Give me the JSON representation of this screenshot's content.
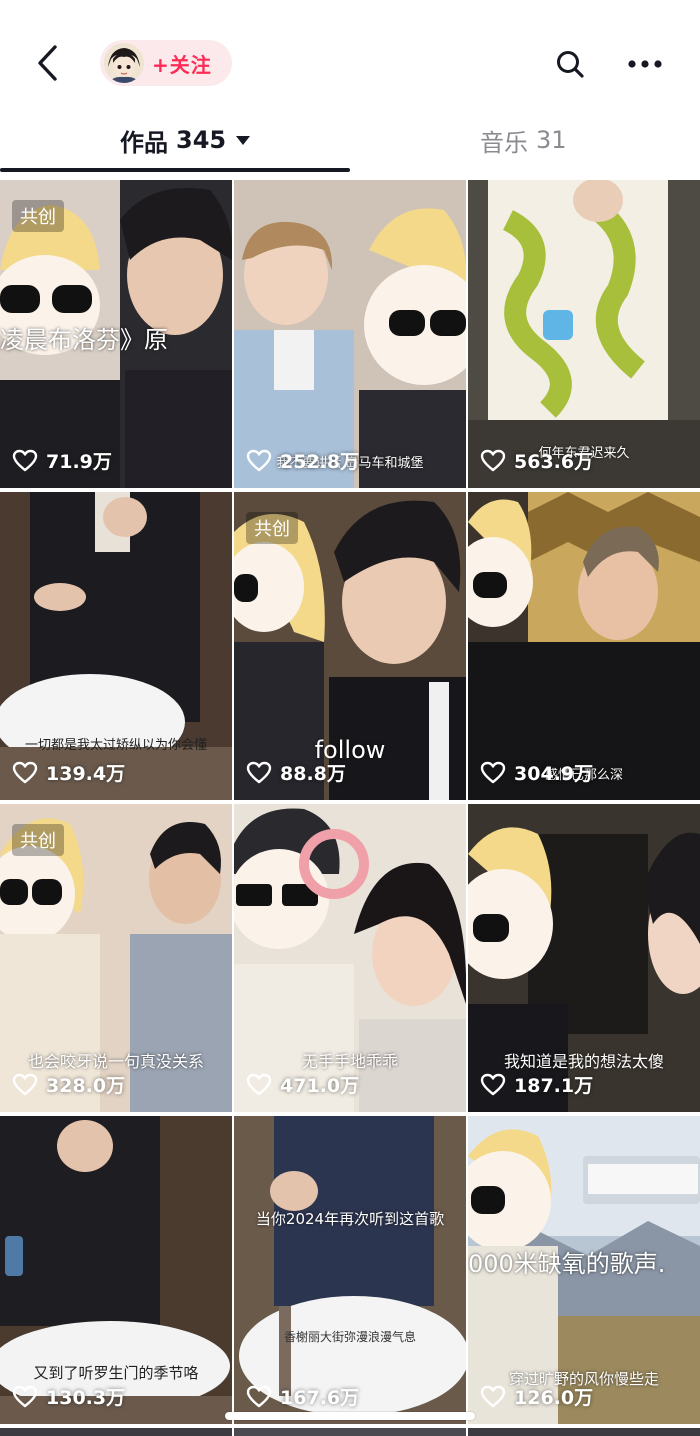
{
  "header": {
    "follow_label": "+关注"
  },
  "tabs": {
    "works_label": "作品",
    "works_count": "345",
    "music_label": "音乐",
    "music_count": "31"
  },
  "videos": [
    {
      "likes": "71.9万",
      "badge": "共创",
      "caption": "凌晨布洛芬》原"
    },
    {
      "likes": "252.8万",
      "badge": "",
      "caption": "我不要讲话  岛马车和城堡"
    },
    {
      "likes": "563.6万",
      "badge": "",
      "caption": "何年东君迟来久"
    },
    {
      "likes": "139.4万",
      "badge": "",
      "caption": "一切都是我太过矫纵以为你会懂"
    },
    {
      "likes": "88.8万",
      "badge": "共创",
      "caption": "follow"
    },
    {
      "likes": "304.9万",
      "badge": "",
      "caption": "感情已那么深"
    },
    {
      "likes": "328.0万",
      "badge": "共创",
      "caption": "也会咬牙说一句真没关系"
    },
    {
      "likes": "471.0万",
      "badge": "",
      "caption": "无手手地乖乖"
    },
    {
      "likes": "187.1万",
      "badge": "",
      "caption": "我知道是我的想法太傻"
    },
    {
      "likes": "130.3万",
      "badge": "",
      "caption": "又到了听罗生门的季节咯"
    },
    {
      "likes": "167.6万",
      "badge": "",
      "caption": "当你2024年再次听到这首歌",
      "caption2": "香榭丽大街弥漫浪漫气息"
    },
    {
      "likes": "126.0万",
      "badge": "",
      "caption": "000米缺氧的歌声.",
      "caption2": "穿过旷野的风你慢些走"
    }
  ],
  "colors": {
    "accent": "#fe2c55",
    "follow_pill_bg": "#fbe9ec",
    "text_primary": "#161823",
    "text_secondary": "#8a8b91"
  },
  "icons": {
    "back": "chevron-left-icon",
    "search": "search-icon",
    "more": "more-dots-icon",
    "like": "heart-outline-icon",
    "dropdown": "caret-down-icon"
  }
}
